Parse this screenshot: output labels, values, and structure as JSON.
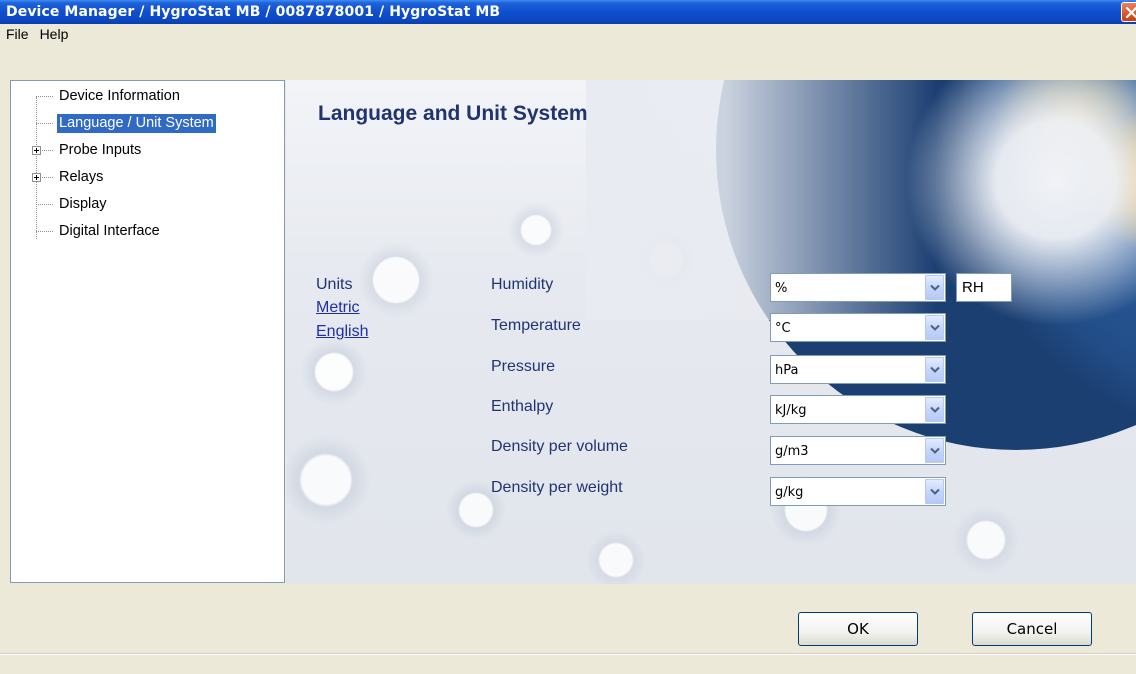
{
  "window": {
    "title": "Device Manager / HygroStat MB / 0087878001 / HygroStat MB",
    "close_icon": "close-icon"
  },
  "menu": {
    "file": "File",
    "help": "Help"
  },
  "tree": {
    "items": [
      {
        "label": "Device Information",
        "expandable": false,
        "selected": false
      },
      {
        "label": "Language / Unit System",
        "expandable": false,
        "selected": true
      },
      {
        "label": "Probe Inputs",
        "expandable": true,
        "selected": false
      },
      {
        "label": "Relays",
        "expandable": true,
        "selected": false
      },
      {
        "label": "Display",
        "expandable": false,
        "selected": false
      },
      {
        "label": "Digital Interface",
        "expandable": false,
        "selected": false
      }
    ]
  },
  "page": {
    "title": "Language and Unit System",
    "units_label": "Units",
    "metric_link": "Metric",
    "english_link": "English"
  },
  "units": [
    {
      "label": "Humidity",
      "value": "%"
    },
    {
      "label": "Temperature",
      "value": "°C"
    },
    {
      "label": "Pressure",
      "value": "hPa"
    },
    {
      "label": "Enthalpy",
      "value": "kJ/kg"
    },
    {
      "label": "Density per volume",
      "value": "g/m3"
    },
    {
      "label": "Density per weight",
      "value": "g/kg"
    }
  ],
  "humidity_suffix": "RH",
  "buttons": {
    "ok": "OK",
    "cancel": "Cancel"
  },
  "colors": {
    "titlebar": "#0f4fcf",
    "selection": "#316ac5",
    "label_text": "#203470",
    "link_text": "#1d2fa8"
  }
}
